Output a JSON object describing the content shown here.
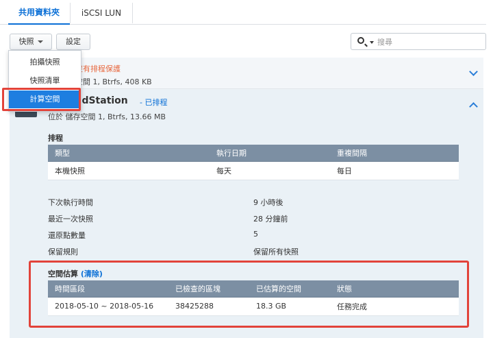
{
  "tabs": [
    "共用資料夾",
    "iSCSI LUN"
  ],
  "toolbar": {
    "snapshot_label": "快照",
    "settings_label": "設定"
  },
  "search": {
    "placeholder": "搜尋"
  },
  "rows": [
    {
      "title": "沒有排程保護",
      "sub": "空間 1, Btrfs, 408 KB"
    },
    {
      "name": "adStation",
      "tag": "- 已排程",
      "sub": "位於 儲存空間 1, Btrfs, 13.66 MB"
    }
  ],
  "schedule": {
    "section_title": "排程",
    "headers": [
      "類型",
      "執行日期",
      "重複間隔"
    ],
    "rows": [
      [
        "本機快照",
        "每天",
        "每日"
      ]
    ]
  },
  "info": [
    {
      "label": "下次執行時間",
      "value": "9 小時後"
    },
    {
      "label": "最近一次快照",
      "value": "28 分鐘前"
    },
    {
      "label": "還原點數量",
      "value": "5"
    },
    {
      "label": "保留規則",
      "value": "保留所有快照"
    }
  ],
  "space": {
    "section_title": "空間估算",
    "clear_link": "(清除)",
    "headers": [
      "時間區段",
      "已檢查的區塊",
      "已估算的空間",
      "狀態"
    ],
    "rows": [
      [
        "2018-05-10 ~ 2018-05-16",
        "38425288",
        "18.3 GB",
        "任務完成"
      ]
    ]
  },
  "menu": {
    "items": [
      "拍攝快照",
      "快照清單",
      "計算空間"
    ],
    "active_index": 2
  },
  "colors": {
    "accent": "#0a6fd6",
    "header": "#7c8fa3",
    "highlight": "#e2433a",
    "warning": "#e8683f"
  }
}
